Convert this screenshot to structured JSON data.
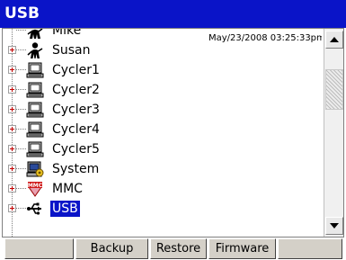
{
  "window": {
    "title": "USB"
  },
  "tree": {
    "timestamp": "May/23/2008 03:25:33pm",
    "items": [
      {
        "label": "Mike",
        "icon": "user-icon",
        "expandable": false,
        "selected": false
      },
      {
        "label": "Susan",
        "icon": "user-icon",
        "expandable": true,
        "selected": false
      },
      {
        "label": "Cycler1",
        "icon": "computer-icon",
        "expandable": true,
        "selected": false
      },
      {
        "label": "Cycler2",
        "icon": "computer-icon",
        "expandable": true,
        "selected": false
      },
      {
        "label": "Cycler3",
        "icon": "computer-icon",
        "expandable": true,
        "selected": false
      },
      {
        "label": "Cycler4",
        "icon": "computer-icon",
        "expandable": true,
        "selected": false
      },
      {
        "label": "Cycler5",
        "icon": "computer-icon",
        "expandable": true,
        "selected": false
      },
      {
        "label": "System",
        "icon": "system-icon",
        "expandable": true,
        "selected": false
      },
      {
        "label": "MMC",
        "icon": "mmc-card-icon",
        "expandable": true,
        "selected": false
      },
      {
        "label": "USB",
        "icon": "usb-icon",
        "expandable": true,
        "selected": true
      }
    ]
  },
  "scrollbar": {
    "position": 0.15
  },
  "toolbar": {
    "buttons": [
      {
        "label": ""
      },
      {
        "label": "Backup"
      },
      {
        "label": "Restore"
      },
      {
        "label": "Firmware"
      },
      {
        "label": ""
      }
    ]
  },
  "colors": {
    "title_bar": "#0a14c8",
    "selection": "#0a14c8",
    "button_face": "#d4d0c8"
  }
}
